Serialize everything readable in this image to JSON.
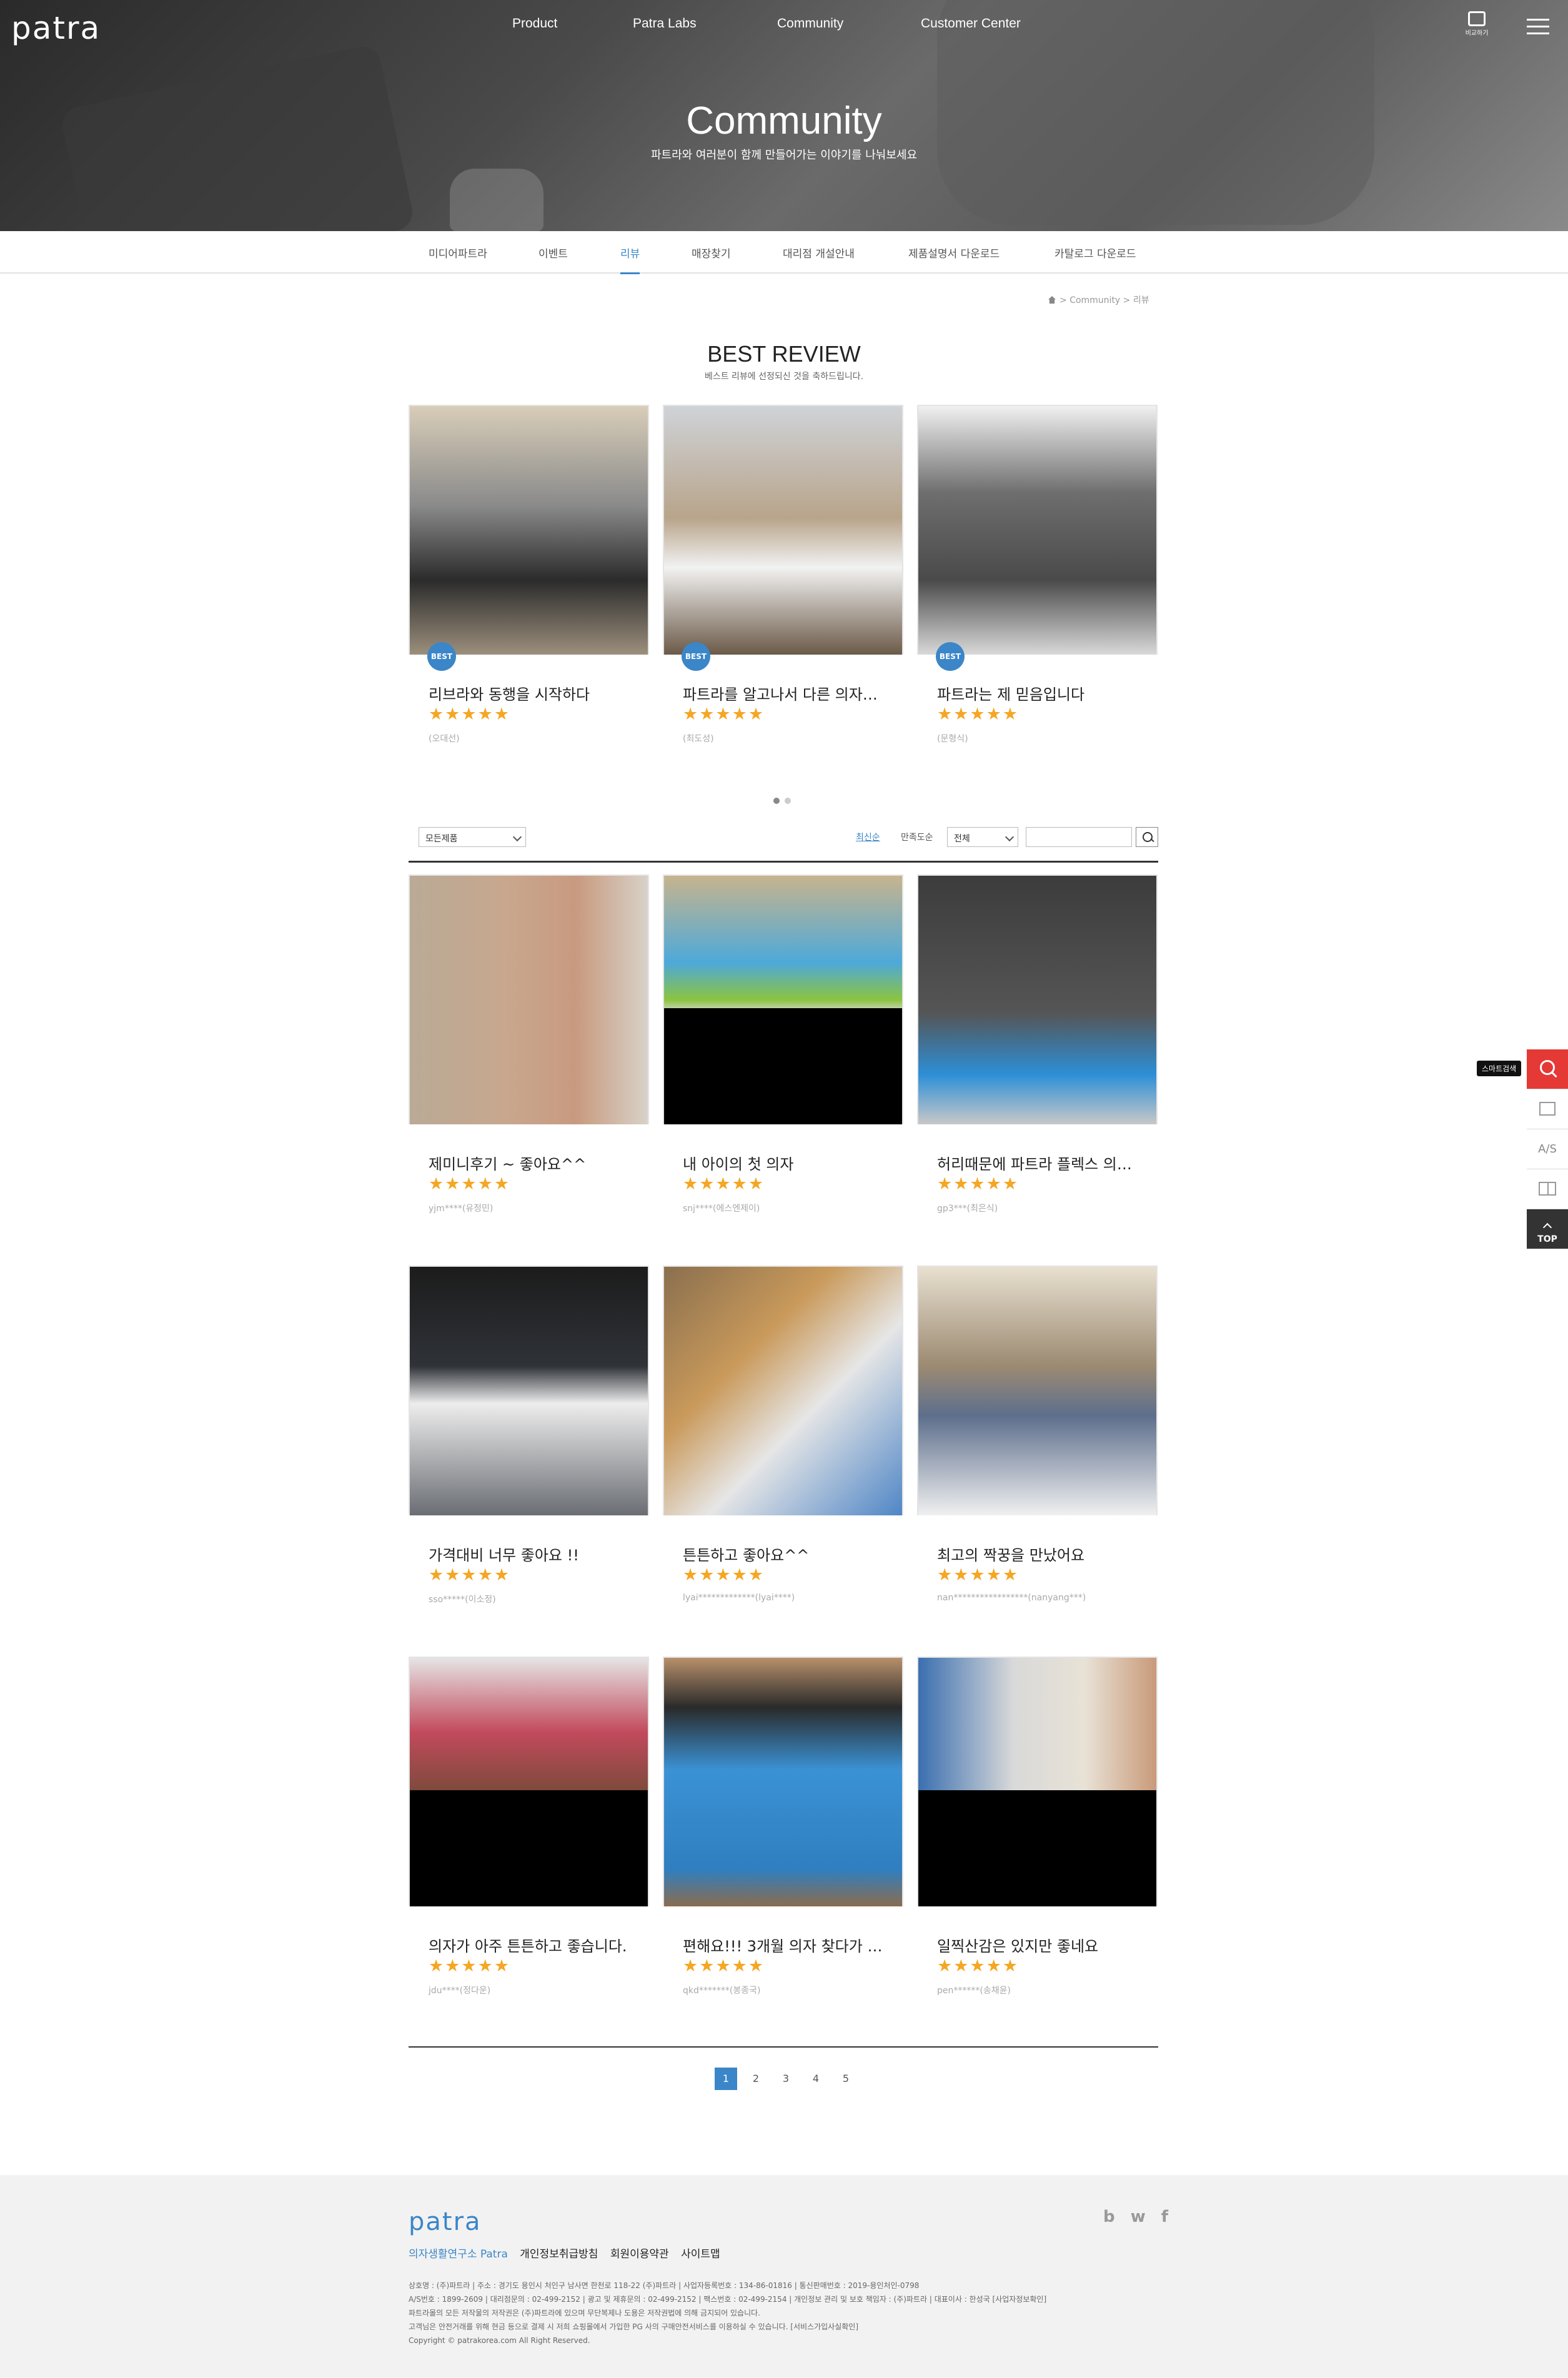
{
  "header": {
    "logo": "patra",
    "nav": [
      "Product",
      "Patra Labs",
      "Community",
      "Customer Center"
    ],
    "compare_label": "비교하기"
  },
  "hero": {
    "title": "Community",
    "subtitle": "파트라와 여러분이 함께 만들어가는 이야기를 나눠보세요"
  },
  "subnav": {
    "tabs": [
      "미디어파트라",
      "이벤트",
      "리뷰",
      "매장찾기",
      "대리점 개설안내",
      "제품설명서 다운로드",
      "카탈로그 다운로드"
    ],
    "active_index": 2
  },
  "breadcrumb": [
    "Community",
    "리뷰"
  ],
  "best_review": {
    "title": "BEST REVIEW",
    "subtitle": "베스트 리뷰에 선정되신 것을 축하드립니다.",
    "badge": "BEST",
    "items": [
      {
        "title": "리브라와 동행을 시작하다",
        "stars": "★★★★★",
        "author": "(오대선)"
      },
      {
        "title": "파트라를 알고나서 다른 의자…",
        "stars": "★★★★★",
        "author": "(최도성)"
      },
      {
        "title": "파트라는 제 믿음입니다",
        "stars": "★★★★★",
        "author": "(문형식)"
      }
    ]
  },
  "filter": {
    "product_select": "모든제품",
    "sort_latest": "최신순",
    "sort_satisfaction": "만족도순",
    "range_select": "전체",
    "search_value": ""
  },
  "reviews": [
    {
      "title": "제미니후기 ~ 좋아요^^",
      "stars": "★★★★★",
      "author": "yjm****(유정민)"
    },
    {
      "title": "내 아이의 첫 의자",
      "stars": "★★★★★",
      "author": "snj****(에스엔제이)"
    },
    {
      "title": "허리때문에 파트라 플렉스 의…",
      "stars": "★★★★★",
      "author": "gp3***(최은식)"
    },
    {
      "title": "가격대비 너무 좋아요 !!",
      "stars": "★★★★★",
      "author": "sso*****(이소정)"
    },
    {
      "title": "튼튼하고 좋아요^^",
      "stars": "★★★★★",
      "author": "lyai*************(lyai****)"
    },
    {
      "title": "최고의 짝꿍을 만났어요",
      "stars": "★★★★★",
      "author": "nan*****************(nanyang***)"
    },
    {
      "title": "의자가 아주 튼튼하고 좋습니다.",
      "stars": "★★★★★",
      "author": "jdu****(정다운)"
    },
    {
      "title": "편해요!!! 3개월 의자 찾다가 구…",
      "stars": "★★★★★",
      "author": "qkd*******(봉종국)"
    },
    {
      "title": "일찍산감은 있지만 좋네요",
      "stars": "★★★★★",
      "author": "pen******(송채윤)"
    }
  ],
  "pagination": [
    "1",
    "2",
    "3",
    "4",
    "5"
  ],
  "quick_menu": {
    "tooltip": "스마트검색",
    "as_label": "A/S",
    "top_label": "TOP"
  },
  "footer": {
    "logo": "patra",
    "links": [
      "의자생활연구소 Patra",
      "개인정보취급방침",
      "회원이용약관",
      "사이트맵"
    ],
    "info": [
      "상호명 : (주)파트라    |    주소 : 경기도 용인시 처인구 남사면 한천로 118-22 (주)파트라    |    사업자등록번호 : 134-86-01816    |    통신판매번호 : 2019-용인처인-0798",
      "A/S번호 : 1899-2609    |    대리점문의 : 02-499-2152    |    광고 및 제휴문의 : 02-499-2152    |    팩스번호 : 02-499-2154    |    개인정보 관리 및 보호 책임자 : (주)파트라    |    대표이사 : 한성국 [사업자정보확인]",
      "파트라몰의 모든 저작물의 저작권은 (주)파트라에 있으며 무단복제나 도용은 저작권법에 의해 금지되어 있습니다.",
      "고객님은 안전거래를 위해 현금 등으로 결제 시 저희 쇼핑몰에서 가입한 PG 사의 구매안전서비스를 이용하실 수 있습니다. [서비스가입사실확인]",
      "Copyright © patrakorea.com All Right Reserved."
    ],
    "sns": [
      "b",
      "w",
      "f"
    ]
  },
  "colors": {
    "accent": "#3b86c8",
    "star": "#f5a623",
    "quick_red": "#e53935"
  }
}
